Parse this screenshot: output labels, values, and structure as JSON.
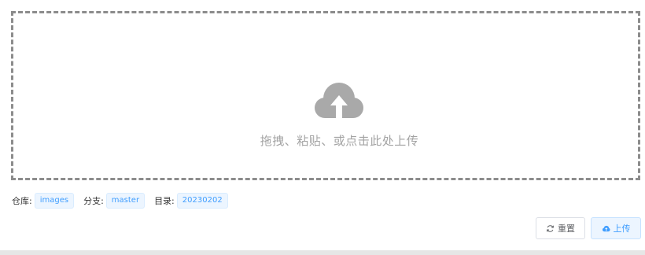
{
  "dropzone": {
    "hint": "拖拽、粘贴、或点击此处上传",
    "icon": "cloud-upload-icon",
    "icon_color": "#a9a9a9"
  },
  "meta": {
    "repo_label": "仓库:",
    "repo_value": "images",
    "branch_label": "分支:",
    "branch_value": "master",
    "dir_label": "目录:",
    "dir_value": "20230202"
  },
  "actions": {
    "reset_label": "重置",
    "reset_icon": "refresh-icon",
    "upload_label": "上传",
    "upload_icon": "cloud-upload-icon"
  },
  "colors": {
    "accent": "#409eff",
    "tag_bg": "#ecf5ff",
    "border_dashed": "#8c8c8c"
  }
}
